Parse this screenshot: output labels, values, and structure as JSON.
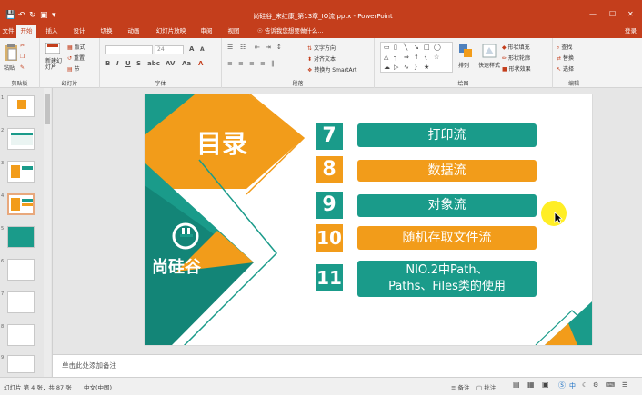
{
  "window": {
    "title": "尚硅谷_宋红康_第13章_IO流.pptx - PowerPoint",
    "controls": [
      "—",
      "☐",
      "✕"
    ]
  },
  "tabs": [
    "文件",
    "开始",
    "插入",
    "设计",
    "切换",
    "动画",
    "幻灯片放映",
    "审阅",
    "视图"
  ],
  "active_tab": "开始",
  "tellme": "告诉我您想要做什么...",
  "signin": "登录",
  "ribbon": {
    "clipboard": {
      "label": "剪贴板",
      "cut": "剪切",
      "copy": "复制",
      "paste_format": "格式刷",
      "paste": "粘贴"
    },
    "slides": {
      "label": "幻灯片",
      "new_slide": "新建幻灯片",
      "layout": "版式",
      "reset": "重置",
      "section": "节"
    },
    "font": {
      "label": "字体",
      "size": "24"
    },
    "paragraph": {
      "label": "段落",
      "text_direction": "文字方向",
      "align_text": "对齐文本",
      "smartart": "转换为 SmartArt"
    },
    "drawing": {
      "label": "绘图",
      "arrange": "排列",
      "quick_styles": "快速样式",
      "fill": "形状填充",
      "outline": "形状轮廓",
      "effects": "形状效果"
    },
    "editing": {
      "label": "编辑",
      "find": "查找",
      "replace": "替换",
      "select": "选择"
    }
  },
  "slide": {
    "title": "目录",
    "brand": "尚硅谷",
    "items": [
      {
        "num": "7",
        "text": "打印流",
        "color": "#1a9b8a"
      },
      {
        "num": "8",
        "text": "数据流",
        "color": "#f29c1a"
      },
      {
        "num": "9",
        "text": "对象流",
        "color": "#1a9b8a"
      },
      {
        "num": "10",
        "text": "随机存取文件流",
        "color": "#f29c1a"
      },
      {
        "num": "11",
        "text": "NIO.2中Path、Paths、Files类的使用",
        "color": "#1a9b8a"
      }
    ],
    "colors": {
      "teal": "#1a9b8a",
      "orange": "#f29c1a"
    }
  },
  "notes_placeholder": "单击此处添加备注",
  "status": {
    "slide_info": "幻灯片 第 4 张，共 87 张",
    "language": "中文(中国)",
    "notes": "备注",
    "comments": "批注"
  },
  "thumb_numbers": [
    "1",
    "2",
    "3",
    "4",
    "5",
    "6",
    "7",
    "8",
    "9"
  ]
}
